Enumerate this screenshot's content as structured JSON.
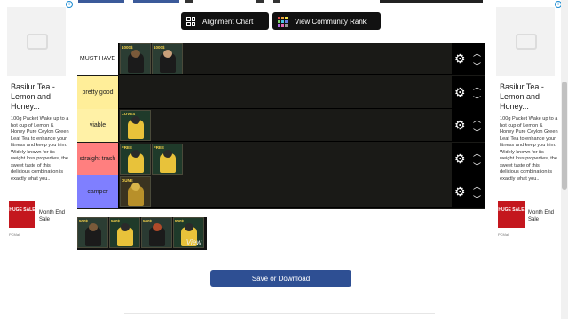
{
  "top_buttons": {
    "alignment_label": "Alignment Chart",
    "community_label": "View Community Rank"
  },
  "tiers": [
    {
      "label": "MUST HAVE",
      "color": "#ffffff",
      "items": [
        {
          "caption": "1000$",
          "icon": "bearded-man-suit-card"
        },
        {
          "caption": "1000$",
          "icon": "bald-man-suit-card"
        }
      ]
    },
    {
      "label": "pretty good",
      "color": "#ffee99",
      "items": []
    },
    {
      "label": "viable",
      "color": "#fff1a6",
      "items": [
        {
          "caption": "LOVES",
          "icon": "yellow-suit-fighter-card"
        }
      ]
    },
    {
      "label": "straight trash",
      "color": "#ff7f7f",
      "items": [
        {
          "caption": "FREE",
          "icon": "yellow-suit-fighter-card"
        },
        {
          "caption": "FREE",
          "icon": "yellow-suit-fighter-card"
        }
      ]
    },
    {
      "label": "camper",
      "color": "#7f7fff",
      "items": [
        {
          "caption": "DUNE",
          "icon": "golden-shield-card"
        }
      ]
    }
  ],
  "pool": {
    "items": [
      {
        "caption": "500$",
        "icon": "dark-haired-man-card"
      },
      {
        "caption": "500$",
        "icon": "yellow-suit-fighter-card"
      },
      {
        "caption": "500$",
        "icon": "red-haired-man-card"
      },
      {
        "caption": "500$",
        "icon": "yellow-suit-fighter-card",
        "overlay": "View"
      }
    ]
  },
  "save_button": {
    "label": "Save or Download"
  },
  "ads": {
    "left": {
      "title": "Basilur Tea - Lemon and Honey...",
      "description": "100g Packet Wake up to a hot cup of Lemon & Honey Pure Ceylon Green Leaf Tea to enhance your fitness and keep you trim. Widely known for its weight loss properties, the sweet taste of this delicious combination is exactly what you...",
      "sale_badge": "HUGE SALE",
      "sale_text": "Month End Sale",
      "brand": "PCMall"
    },
    "right": {
      "title": "Basilur Tea - Lemon and Honey...",
      "description": "100g Packet Wake up to a hot cup of Lemon & Honey Pure Ceylon Green Leaf Tea to enhance your fitness and keep you trim. Widely known for its weight loss properties, the sweet taste of this delicious combination is exactly what you...",
      "sale_badge": "HUGE SALE",
      "sale_text": "Month End Sale",
      "brand": "PCMall"
    }
  }
}
